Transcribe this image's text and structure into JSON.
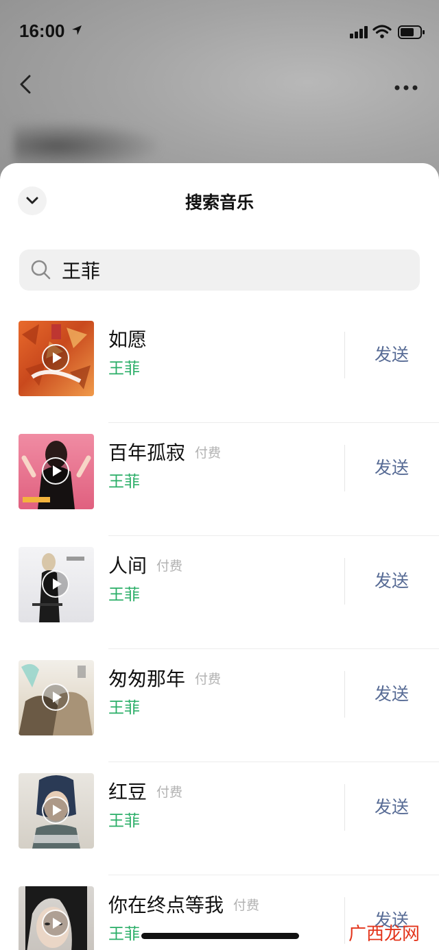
{
  "status_bar": {
    "time": "16:00"
  },
  "sheet": {
    "title": "搜索音乐"
  },
  "search": {
    "query": "王菲"
  },
  "results": [
    {
      "title": "如愿",
      "badge": "",
      "artist": "王菲",
      "send_label": "发送"
    },
    {
      "title": "百年孤寂",
      "badge": "付费",
      "artist": "王菲",
      "send_label": "发送"
    },
    {
      "title": "人间",
      "badge": "付费",
      "artist": "王菲",
      "send_label": "发送"
    },
    {
      "title": "匆匆那年",
      "badge": "付费",
      "artist": "王菲",
      "send_label": "发送"
    },
    {
      "title": "红豆",
      "badge": "付费",
      "artist": "王菲",
      "send_label": "发送"
    },
    {
      "title": "你在终点等我",
      "badge": "付费",
      "artist": "王菲",
      "send_label": "发送"
    }
  ],
  "watermark": "广西龙网",
  "colors": {
    "artist_green": "#2aae67",
    "send_blue": "#576b95",
    "badge_gray": "#b2b2b2"
  }
}
